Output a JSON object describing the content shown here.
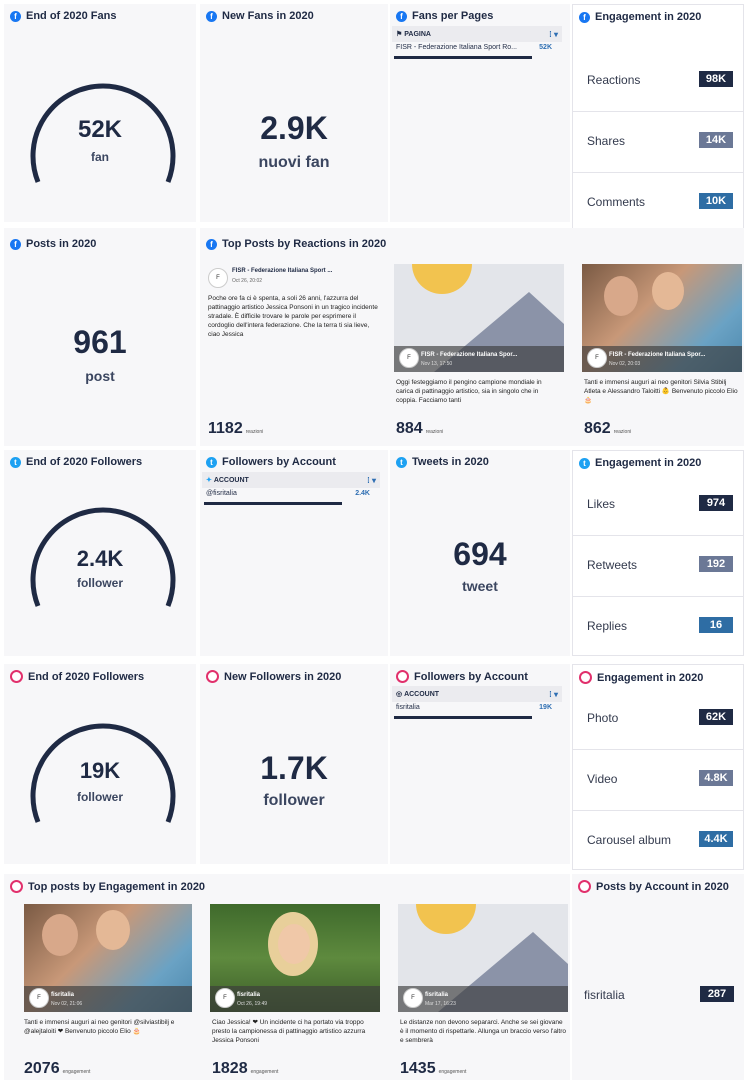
{
  "fb_fans": {
    "title": "End of 2020 Fans",
    "value": "52K",
    "unit": "fan"
  },
  "fb_newfans": {
    "title": "New Fans in 2020",
    "value": "2.9K",
    "unit": "nuovi fan"
  },
  "fb_pages": {
    "title": "Fans per Pages",
    "col": "PAGINA",
    "row": "FISR - Federazione Italiana Sport Ro...",
    "value": "52K"
  },
  "fb_eng": {
    "title": "Engagement in 2020",
    "rows": [
      {
        "label": "Reactions",
        "value": "98K"
      },
      {
        "label": "Shares",
        "value": "14K"
      },
      {
        "label": "Comments",
        "value": "10K"
      }
    ]
  },
  "fb_posts": {
    "title": "Posts in 2020",
    "value": "961",
    "unit": "post"
  },
  "fb_top": {
    "title": "Top Posts by Reactions in 2020",
    "posts": [
      {
        "name": "FISR - Federazione Italiana Sport ...",
        "date": "Oct 26, 20:02",
        "text": "Poche ore fa ci è spenta, a soli 26 anni, l'azzurra del pattinaggio artistico Jessica Ponsoni in un tragico incidente stradale. È difficile trovare le parole per esprimere il cordoglio dell'intera federazione. Che la terra ti sia lieve, ciao Jessica",
        "value": "1182",
        "metric": "reazioni"
      },
      {
        "name": "FISR - Federazione Italiana Spor...",
        "date": "Nov 13, 17:50",
        "text": "Oggi festeggiamo il pengino campione mondiale in carica di pattinaggio artistico, sia in singolo che in coppia. Facciamo tanti",
        "value": "884",
        "metric": "reazioni"
      },
      {
        "name": "FISR - Federazione Italiana Spor...",
        "date": "Nov 02, 20:03",
        "text": "Tanti e immensi auguri ai neo genitori Silvia Stibilj Atleta e Alessandro Taloitti 👶 Benvenuto piccolo Elio 🎂",
        "value": "862",
        "metric": "reazioni"
      }
    ]
  },
  "tw_followers": {
    "title": "End of 2020 Followers",
    "value": "2.4K",
    "unit": "follower"
  },
  "tw_acct": {
    "title": "Followers by Account",
    "col": "ACCOUNT",
    "row": "@fisritalia",
    "value": "2.4K"
  },
  "tw_tweets": {
    "title": "Tweets in 2020",
    "value": "694",
    "unit": "tweet"
  },
  "tw_eng": {
    "title": "Engagement in 2020",
    "rows": [
      {
        "label": "Likes",
        "value": "974"
      },
      {
        "label": "Retweets",
        "value": "192"
      },
      {
        "label": "Replies",
        "value": "16"
      }
    ]
  },
  "ig_followers": {
    "title": "End of 2020 Followers",
    "value": "19K",
    "unit": "follower"
  },
  "ig_new": {
    "title": "New Followers in 2020",
    "value": "1.7K",
    "unit": "follower"
  },
  "ig_acct": {
    "title": "Followers by Account",
    "col": "ACCOUNT",
    "row": "fisritalia",
    "value": "19K"
  },
  "ig_eng": {
    "title": "Engagement in 2020",
    "rows": [
      {
        "label": "Photo",
        "value": "62K"
      },
      {
        "label": "Video",
        "value": "4.8K"
      },
      {
        "label": "Carousel album",
        "value": "4.4K"
      }
    ]
  },
  "ig_top": {
    "title": "Top posts by Engagement in 2020",
    "posts": [
      {
        "name": "fisritalia",
        "date": "Nov 02, 21:06",
        "text": "Tanti e immensi auguri ai neo genitori @silviastibilj e @alejtaloiti ❤ Benvenuto piccolo Elio 🎂",
        "value": "2076",
        "metric": "engagement"
      },
      {
        "name": "fisritalia",
        "date": "Oct 26, 19:49",
        "text": "Ciao Jessica! ❤ Un incidente ci ha portato via troppo presto la campionessa di pattinaggio artistico azzurra Jessica Ponsoni",
        "value": "1828",
        "metric": "engagement"
      },
      {
        "name": "fisritalia",
        "date": "Mar 17, 16:23",
        "text": "Le distanze non devono separarci. Anche se sei giovane è il momento di rispettarle. Allunga un braccio verso l'altro e sembrerà",
        "value": "1435",
        "metric": "engagement"
      }
    ]
  },
  "ig_posts_acct": {
    "title": "Posts by Account in 2020",
    "row": "fisritalia",
    "value": "287"
  },
  "colors": {
    "navy": "#1f2a44",
    "badge_dark": "#1f2a44",
    "badge_mid": "#6b7896",
    "badge_blue": "#2e6da4"
  }
}
